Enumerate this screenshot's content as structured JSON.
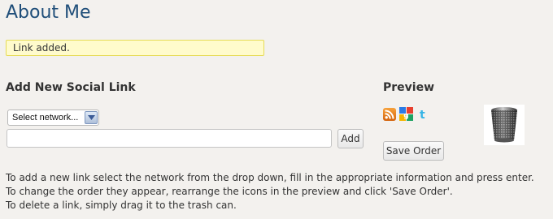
{
  "page": {
    "title": "About Me"
  },
  "notice": {
    "text": "Link added."
  },
  "add_section": {
    "heading": "Add New Social Link",
    "select": {
      "selected": "Select network..."
    },
    "input": {
      "value": "",
      "placeholder": ""
    },
    "add_button": "Add"
  },
  "preview_section": {
    "heading": "Preview",
    "icons": [
      "rss-icon",
      "google-icon",
      "twitter-icon"
    ],
    "save_button": "Save Order",
    "trash": "trash-can-icon"
  },
  "help": [
    "To add a new link select the network from the drop down, fill in the appropriate information and press enter.",
    "To change the order they appear, rearrange the icons in the preview and click 'Save Order'.",
    "To delete a link, simply drag it to the trash can."
  ],
  "colors": {
    "title": "#1f4e79",
    "notice_bg": "#fffbcc",
    "notice_border": "#e6db55",
    "background": "#f3f1ee"
  }
}
